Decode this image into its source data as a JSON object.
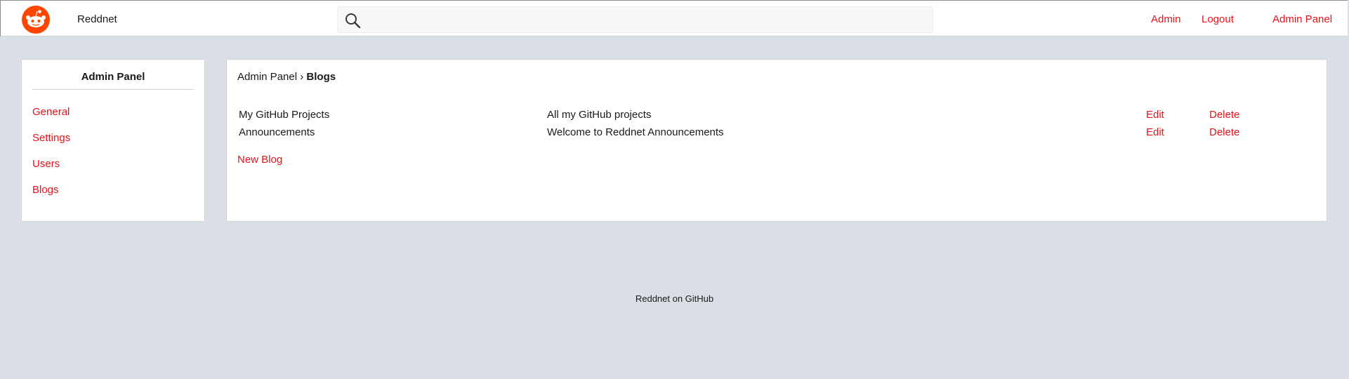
{
  "header": {
    "brand": "Reddnet",
    "search_placeholder": "",
    "search_value": "",
    "links": {
      "admin": "Admin",
      "logout": "Logout",
      "admin_panel": "Admin Panel"
    }
  },
  "sidebar": {
    "title": "Admin Panel",
    "items": [
      {
        "label": "General"
      },
      {
        "label": "Settings"
      },
      {
        "label": "Users"
      },
      {
        "label": "Blogs"
      }
    ]
  },
  "main": {
    "breadcrumb": {
      "parent": "Admin Panel",
      "separator": "›",
      "current": "Blogs"
    },
    "blogs": [
      {
        "name": "My GitHub Projects",
        "description": "All my GitHub projects",
        "edit": "Edit",
        "delete": "Delete"
      },
      {
        "name": "Announcements",
        "description": "Welcome to Reddnet Announcements",
        "edit": "Edit",
        "delete": "Delete"
      }
    ],
    "new_blog": "New Blog"
  },
  "footer": {
    "text": "Reddnet on GitHub"
  },
  "colors": {
    "accent": "#e5131b",
    "logo": "#ff4500",
    "background": "#dadee5"
  },
  "icons": {
    "logo": "reddit-alien-logo",
    "search": "search-icon"
  }
}
